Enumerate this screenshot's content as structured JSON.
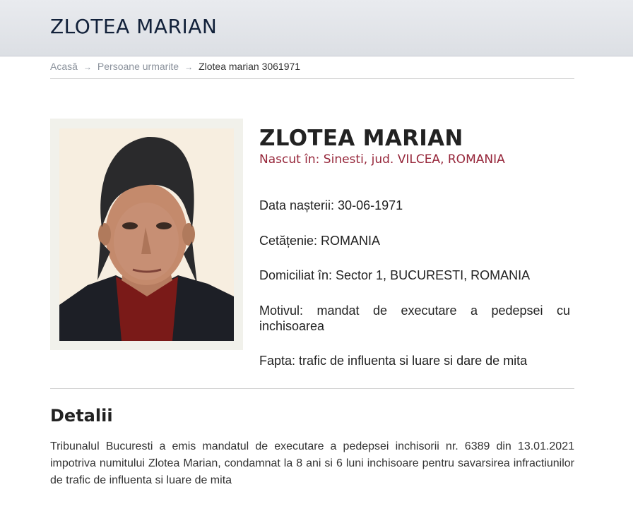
{
  "header": {
    "title": "ZLOTEA MARIAN"
  },
  "breadcrumb": {
    "home": "Acasă",
    "section": "Persoane urmarite",
    "current": "Zlotea marian 3061971",
    "separator": "→"
  },
  "profile": {
    "name": "ZLOTEA MARIAN",
    "birthplace": "Nascut în: Sinesti, jud. VILCEA, ROMANIA",
    "birth_date": "Data nașterii: 30-06-1971",
    "citizenship": "Cetățenie: ROMANIA",
    "residence": "Domiciliat în: Sector 1, BUCURESTI, ROMANIA",
    "reason": "Motivul: mandat de executare a pedepsei cu inchisoarea",
    "offense": "Fapta: trafic de influenta si luare si dare de mita"
  },
  "details": {
    "heading": "Detalii",
    "text": "Tribunalul Bucuresti a emis mandatul de executare a pedepsei inchisorii nr. 6389 din 13.01.2021 impotriva numitului Zlotea Marian, condamnat la 8 ani si 6 luni inchisoare pentru savarsirea infractiunilor de trafic de influenta si luare de mita"
  },
  "colors": {
    "header_bg": "#e3e6ea",
    "title_text": "#12213a",
    "birthplace_text": "#96263a",
    "photo_frame": "#f1f1eb"
  }
}
